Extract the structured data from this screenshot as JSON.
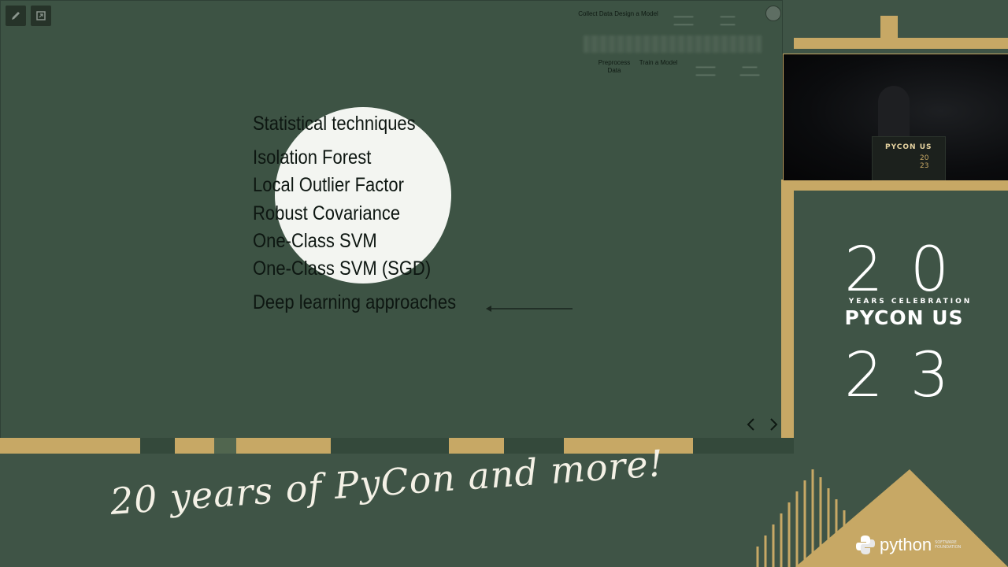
{
  "toolbar": {
    "edit_icon": "pencil-icon",
    "fullscreen_icon": "expand-icon"
  },
  "pipeline": {
    "top": [
      {
        "label": "Collect Data",
        "visible": true
      },
      {
        "label": "Design a Model",
        "visible": true
      },
      {
        "label": "",
        "visible": false
      },
      {
        "label": "",
        "visible": false
      }
    ],
    "bottom": [
      {
        "label": "Preprocess Data",
        "visible": true
      },
      {
        "label": "Train a Model",
        "visible": true
      },
      {
        "label": "",
        "visible": false
      },
      {
        "label": "",
        "visible": false
      }
    ]
  },
  "slide": {
    "heading": "Statistical techniques",
    "items": [
      "Isolation Forest",
      "Local Outlier Factor",
      "Robust Covariance",
      "One-Class SVM",
      "One-Class SVM (SGD)"
    ],
    "footer_item": "Deep learning approaches"
  },
  "nav": {
    "prev_icon": "chevron-left-icon",
    "next_icon": "chevron-right-icon"
  },
  "speaker": {
    "podium_text": "PYCON US",
    "podium_year_top": "20",
    "podium_year_bottom": "23"
  },
  "logo": {
    "year_top": "20",
    "subtitle": "YEARS CELEBRATION",
    "name": "PYCON US",
    "year_bottom": "23"
  },
  "banner": {
    "tagline": "20 years of PyCon and more!"
  },
  "sponsor": {
    "word": "python",
    "small": "SOFTWARE FOUNDATION"
  },
  "colors": {
    "background": "#3f5446",
    "gold": "#c7a865",
    "spotlight": "#f3f5f1"
  }
}
